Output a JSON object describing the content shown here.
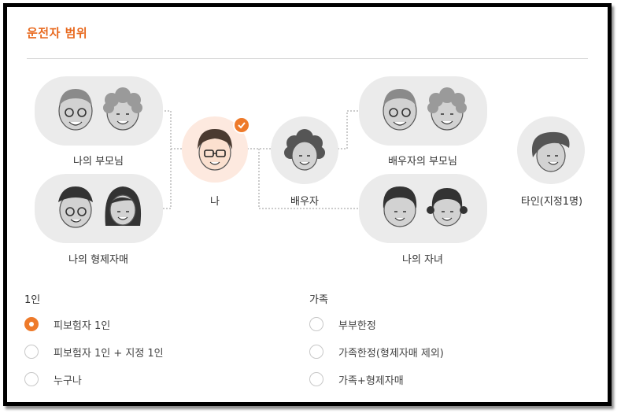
{
  "section_title": "운전자 범위",
  "diagram": {
    "my_parents": "나의 부모님",
    "my_siblings": "나의 형제자매",
    "me": "나",
    "spouse": "배우자",
    "spouse_parents": "배우자의 부모님",
    "my_children": "나의 자녀",
    "other": "타인(지정1명)",
    "selected_node": "me"
  },
  "groups": [
    {
      "title": "1인",
      "options": [
        {
          "label": "피보험자 1인",
          "selected": true
        },
        {
          "label": "피보험자 1인 + 지정 1인",
          "selected": false
        },
        {
          "label": "누구나",
          "selected": false
        }
      ]
    },
    {
      "title": "가족",
      "options": [
        {
          "label": "부부한정",
          "selected": false
        },
        {
          "label": "가족한정(형제자매 제외)",
          "selected": false
        },
        {
          "label": "가족+형제자매",
          "selected": false
        }
      ]
    }
  ],
  "colors": {
    "accent": "#ee7a2a",
    "title": "#e8691e",
    "bubble": "#ebebeb",
    "bubble_me": "#fde9df"
  },
  "icons": [
    "grandpa-icon",
    "grandma-icon",
    "brother-icon",
    "sister-icon",
    "me-icon",
    "check-icon",
    "spouse-icon",
    "boy-icon",
    "girl-icon",
    "other-person-icon"
  ]
}
